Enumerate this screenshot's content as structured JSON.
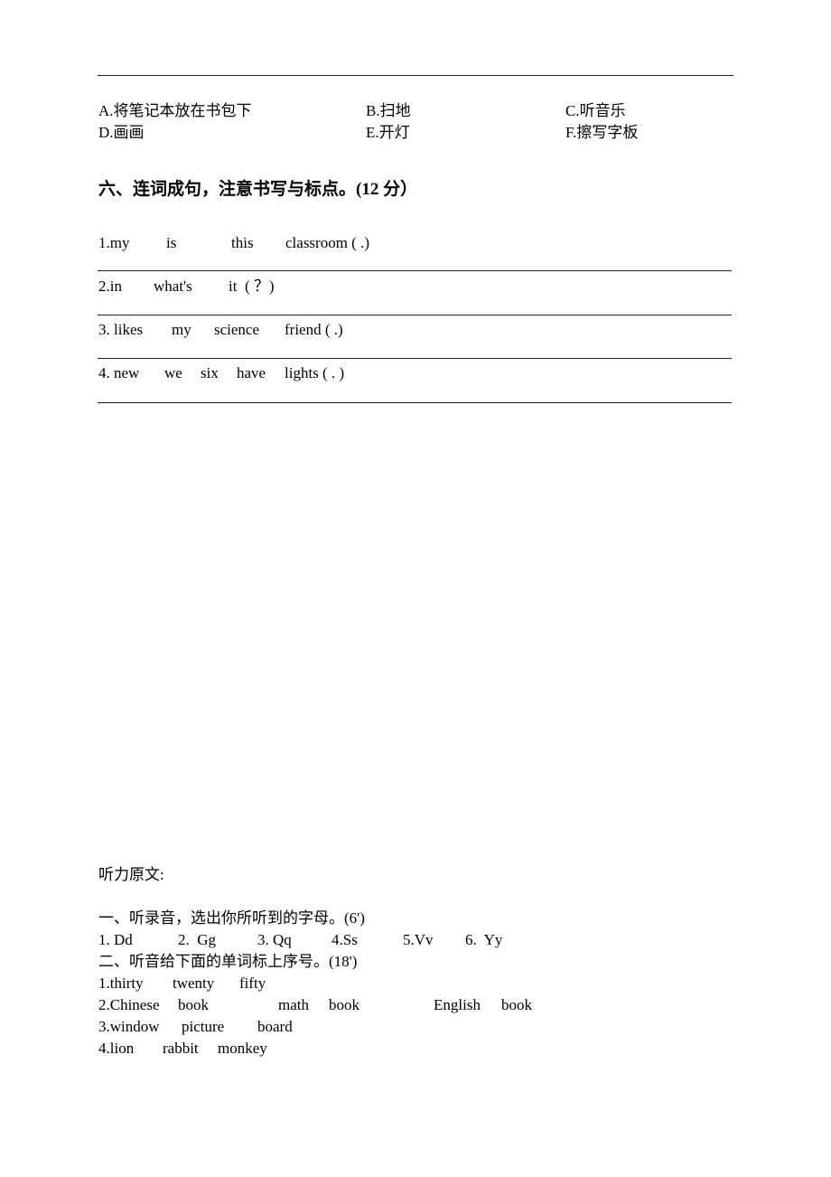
{
  "options": {
    "row1": [
      "A.将笔记本放在书包下",
      "B.扫地",
      "C.听音乐"
    ],
    "row2": [
      "D.画画",
      "E.开灯",
      "F.擦写字板"
    ]
  },
  "section6": {
    "title": "六、连词成句，注意书写与标点。(12 分）",
    "items": [
      {
        "words": [
          "1.my",
          "is",
          "this",
          "classroom ( .)"
        ]
      },
      {
        "words": [
          "2.in",
          "what's",
          "it  ( ？)"
        ]
      },
      {
        "words": [
          "3. likes",
          "my",
          "science",
          "friend ( .)"
        ]
      },
      {
        "words": [
          "4. new",
          "we",
          "six",
          "have",
          "lights ( . )"
        ]
      }
    ]
  },
  "listening": {
    "title": "听力原文:",
    "part1": {
      "title": "一、听录音，选出你所听到的字母。(6')",
      "items": [
        "1. Dd",
        "2.  Gg",
        "3. Qq",
        "4.Ss",
        "5.Vv",
        "6.  Yy"
      ]
    },
    "part2": {
      "title": "二、听音给下面的单词标上序号。(18')",
      "rows": [
        [
          "1.thirty",
          "twenty",
          "fifty"
        ],
        [
          "2.Chinese",
          "book",
          "math",
          "book",
          "English",
          "book"
        ],
        [
          "3.window",
          "picture",
          "board"
        ],
        [
          "4.lion",
          "rabbit",
          "monkey"
        ]
      ]
    }
  }
}
